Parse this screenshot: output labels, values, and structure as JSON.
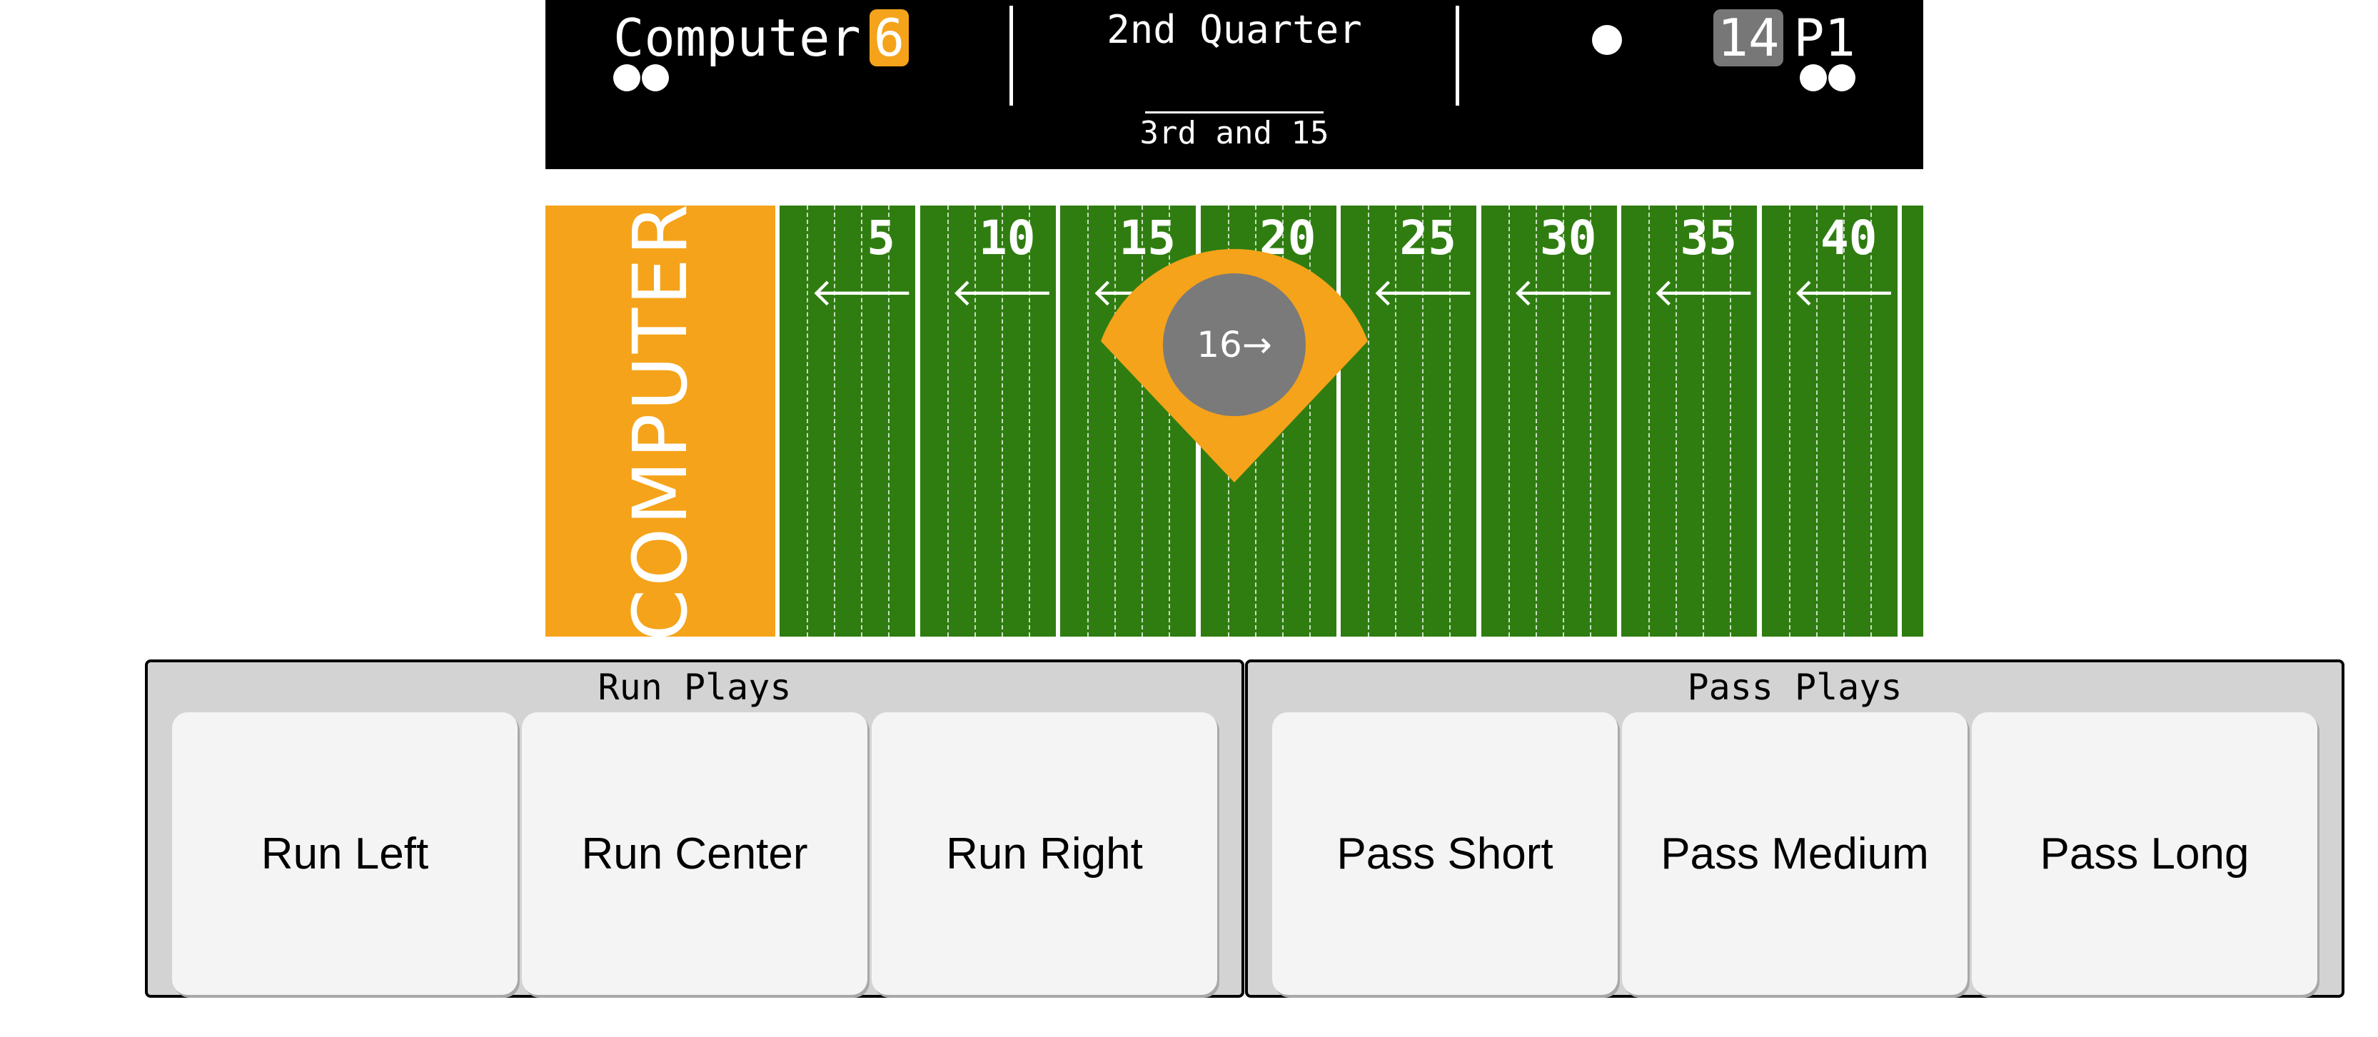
{
  "scoreboard": {
    "left_team": {
      "name": "Computer",
      "score": "6"
    },
    "right_team": {
      "name": "P1",
      "score": "14"
    },
    "quarter": "2nd Quarter",
    "down_distance": "3rd and 15"
  },
  "field": {
    "endzone_label": "COMPUTER",
    "yard_markers": [
      "5",
      "10",
      "15",
      "20",
      "25",
      "30",
      "35",
      "40"
    ],
    "direction_arrow": "🡐",
    "ball": {
      "label": "16→",
      "yard_line": 16
    }
  },
  "run_plays": {
    "title": "Run Plays",
    "buttons": [
      "Run Left",
      "Run Center",
      "Run Right"
    ]
  },
  "pass_plays": {
    "title": "Pass Plays",
    "buttons": [
      "Pass Short",
      "Pass Medium",
      "Pass Long"
    ]
  },
  "colors": {
    "computer_accent": "#f5a31a",
    "p1_accent": "#777777",
    "field_green": "#2f7d10",
    "scoreboard_bg": "#000000"
  }
}
